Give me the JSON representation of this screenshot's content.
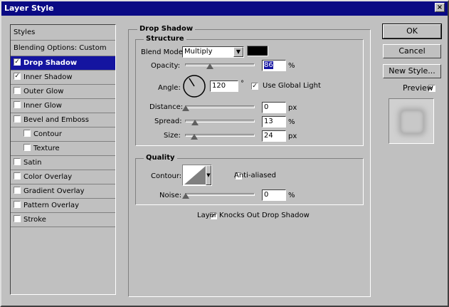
{
  "window": {
    "title": "Layer Style",
    "close_glyph": "×"
  },
  "styles_list": {
    "header": "Styles",
    "items": [
      {
        "label": "Blending Options: Custom",
        "checkbox": false,
        "checked": false,
        "selected": false,
        "indent": false
      },
      {
        "label": "Drop Shadow",
        "checkbox": true,
        "checked": true,
        "selected": true,
        "indent": false
      },
      {
        "label": "Inner Shadow",
        "checkbox": true,
        "checked": true,
        "selected": false,
        "indent": false
      },
      {
        "label": "Outer Glow",
        "checkbox": true,
        "checked": false,
        "selected": false,
        "indent": false
      },
      {
        "label": "Inner Glow",
        "checkbox": true,
        "checked": false,
        "selected": false,
        "indent": false
      },
      {
        "label": "Bevel and Emboss",
        "checkbox": true,
        "checked": false,
        "selected": false,
        "indent": false
      },
      {
        "label": "Contour",
        "checkbox": true,
        "checked": false,
        "selected": false,
        "indent": true
      },
      {
        "label": "Texture",
        "checkbox": true,
        "checked": false,
        "selected": false,
        "indent": true
      },
      {
        "label": "Satin",
        "checkbox": true,
        "checked": false,
        "selected": false,
        "indent": false
      },
      {
        "label": "Color Overlay",
        "checkbox": true,
        "checked": false,
        "selected": false,
        "indent": false
      },
      {
        "label": "Gradient Overlay",
        "checkbox": true,
        "checked": false,
        "selected": false,
        "indent": false
      },
      {
        "label": "Pattern Overlay",
        "checkbox": true,
        "checked": false,
        "selected": false,
        "indent": false
      },
      {
        "label": "Stroke",
        "checkbox": true,
        "checked": false,
        "selected": false,
        "indent": false
      }
    ]
  },
  "drop_shadow": {
    "group_title": "Drop Shadow",
    "structure": {
      "title": "Structure",
      "blend_mode_label": "Blend Mode:",
      "blend_mode_value": "Multiply",
      "shadow_color": "#000000",
      "opacity_label": "Opacity:",
      "opacity_value": "86",
      "opacity_unit": "%",
      "opacity_fraction": 0.86,
      "angle_label": "Angle:",
      "angle_value": "120",
      "angle_unit": "°",
      "use_global_light_label": "Use Global Light",
      "use_global_light_checked": true,
      "distance_label": "Distance:",
      "distance_value": "0",
      "distance_unit": "px",
      "distance_fraction": 0.0,
      "spread_label": "Spread:",
      "spread_value": "13",
      "spread_unit": "%",
      "spread_fraction": 0.13,
      "size_label": "Size:",
      "size_value": "24",
      "size_unit": "px",
      "size_fraction": 0.12
    },
    "quality": {
      "title": "Quality",
      "contour_label": "Contour:",
      "anti_aliased_label": "Anti-aliased",
      "anti_aliased_checked": false,
      "noise_label": "Noise:",
      "noise_value": "0",
      "noise_unit": "%",
      "noise_fraction": 0.0
    },
    "knockout_label": "Layer Knocks Out Drop Shadow",
    "knockout_checked": true
  },
  "buttons": {
    "ok": "OK",
    "cancel": "Cancel",
    "new_style": "New Style..."
  },
  "preview": {
    "label": "Preview",
    "checked": true
  }
}
